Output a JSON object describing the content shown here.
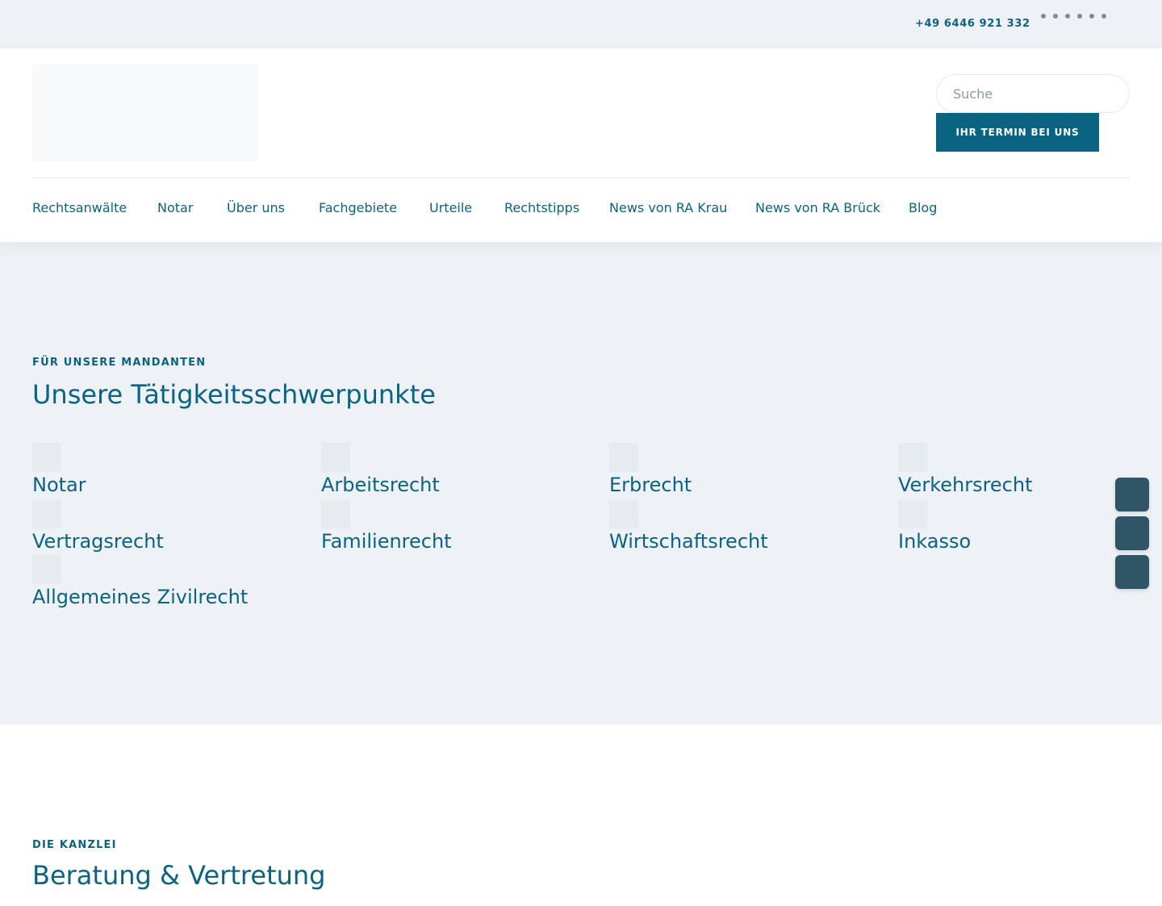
{
  "topbar": {
    "phone": "+49 6446 921 332",
    "social_icons": [
      "social-icon-1",
      "social-icon-2",
      "social-icon-3",
      "social-icon-4",
      "social-icon-5",
      "social-icon-6"
    ]
  },
  "header": {
    "search_placeholder": "Suche",
    "cta_label": "Ihr Termin bei uns",
    "nav": [
      "Rechtsanwälte",
      "Notar",
      "Über uns",
      "Fachgebiete",
      "Urteile",
      "Rechtstipps",
      "News von RA Krau",
      "News von RA Brück",
      "Blog"
    ]
  },
  "areas": {
    "eyebrow": "Für unsere Mandanten",
    "title": "Unsere Tätigkeitsschwerpunkte",
    "items": [
      "Notar",
      "Arbeitsrecht",
      "Erbrecht",
      "Verkehrsrecht",
      "Vertragsrecht",
      "Familienrecht",
      "Wirtschaftsrecht",
      "Inkasso",
      "Allgemeines Zivilrecht"
    ]
  },
  "kanzlei": {
    "eyebrow": "Die Kanzlei",
    "title": "Beratung & Vertretung"
  },
  "colors": {
    "accent": "#0b6382",
    "section_bg": "#eef2f6",
    "side_button": "#2f5566"
  }
}
